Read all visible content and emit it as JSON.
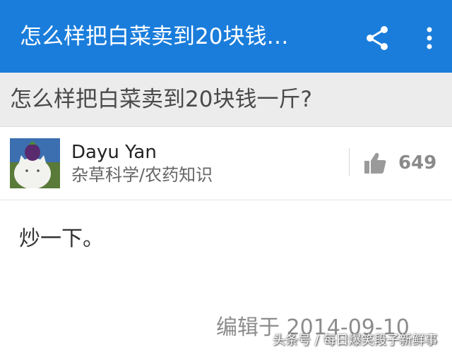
{
  "appbar": {
    "title": "怎么样把白菜卖到20块钱…",
    "share_icon": "share-icon",
    "more_icon": "more-vert-icon",
    "color": "#1a7ddb"
  },
  "question": {
    "title": "怎么样把白菜卖到20块钱一斤?"
  },
  "author": {
    "name": "Dayu Yan",
    "bio": "杂草科学/农药知识",
    "avatar_icon": "avatar-cat-with-eggplant"
  },
  "vote": {
    "icon": "thumbs-up-icon",
    "count": "649"
  },
  "answer": {
    "text": "炒一下。",
    "edited": "编辑于 2014-09-10"
  },
  "watermark": "头条号 / 每日爆笑段子新鲜事"
}
